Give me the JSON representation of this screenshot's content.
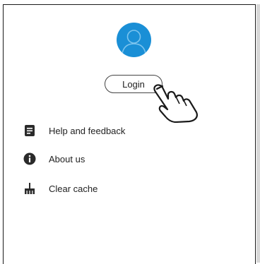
{
  "profile": {
    "login_label": "Login"
  },
  "menu": {
    "items": [
      {
        "label": "Help and feedback",
        "icon": "help-feedback-icon"
      },
      {
        "label": "About us",
        "icon": "info-icon"
      },
      {
        "label": "Clear cache",
        "icon": "broom-icon"
      }
    ]
  },
  "colors": {
    "avatar_bg": "#1a8fd6",
    "icon_dark": "#2a2a2a",
    "border": "#1a1a1a"
  }
}
